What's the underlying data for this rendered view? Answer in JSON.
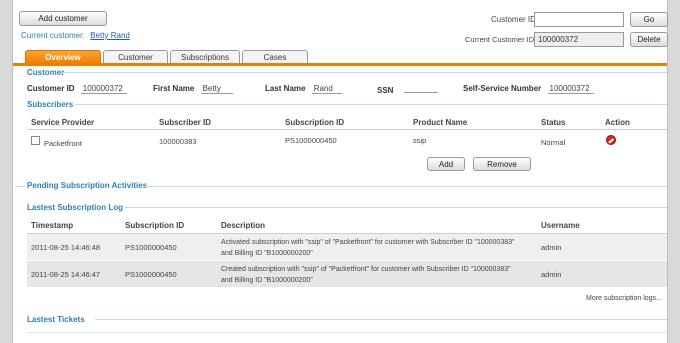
{
  "header": {
    "add_customer_label": "Add customer",
    "current_customer_label": "Current customer:",
    "current_customer_name": "Betty Rand",
    "customer_id_label": "Customer ID:",
    "customer_id_value": "",
    "go_label": "Go",
    "current_customer_id_label": "Current Customer ID:",
    "current_customer_id_value": "100000372",
    "delete_label": "Delete"
  },
  "tabs": [
    {
      "label": "Overview",
      "active": true
    },
    {
      "label": "Customer",
      "active": false
    },
    {
      "label": "Subscriptions",
      "active": false
    },
    {
      "label": "Cases",
      "active": false
    }
  ],
  "customer": {
    "section_title": "Customer",
    "customer_id_label": "Customer ID",
    "customer_id": "100000372",
    "first_name_label": "First Name",
    "first_name": "Betty",
    "last_name_label": "Last Name",
    "last_name": "Rand",
    "ssn_label": "SSN",
    "ssn": "",
    "ssn_number_label": "Self-Service Number",
    "ssn_number": "100000372"
  },
  "subscribers": {
    "section_title": "Subscribers",
    "columns": [
      "Service Provider",
      "Subscriber ID",
      "Subscription ID",
      "Product Name",
      "Status",
      "Action"
    ],
    "rows": [
      {
        "provider": "Packetfront",
        "subscriber_id": "100000383",
        "subscription_id": "PS1000000450",
        "product": "ssip",
        "status": "Normal"
      }
    ],
    "add_label": "Add",
    "remove_label": "Remove"
  },
  "pending": {
    "section_title": "Pending Subscription Activities"
  },
  "log": {
    "section_title": "Lastest Subscription Log",
    "columns": [
      "Timestamp",
      "Subscription ID",
      "Description",
      "Username"
    ],
    "rows": [
      {
        "timestamp": "2011-08-25 14:46:48",
        "subscription_id": "PS1000000450",
        "desc1": "Activated subscription with \"ssip\" of \"Packetfront\" for customer with Subscriber ID \"100000383\"",
        "desc2": "and Billing ID \"B1000000200\"",
        "username": "admin"
      },
      {
        "timestamp": "2011-08-25 14:46:47",
        "subscription_id": "PS1000000450",
        "desc1": "Created subscription with \"ssip\" of \"Packetfront\" for customer with Subscriber ID \"100000383\"",
        "desc2": "and Billing ID \"B1000000200\"",
        "username": "admin"
      }
    ],
    "more_label": "More subscription logs..."
  },
  "tickets": {
    "section_title": "Lastest Tickets"
  }
}
